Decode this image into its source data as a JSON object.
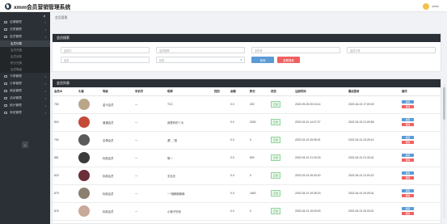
{
  "header": {
    "title": "xmm会员营销管理系统",
    "user_name": "admin"
  },
  "sidebar": {
    "items": [
      {
        "label": "店铺管理",
        "icon": "store-icon"
      },
      {
        "label": "分类管理",
        "icon": "category-icon"
      },
      {
        "label": "会员管理",
        "icon": "member-icon"
      }
    ],
    "sub_items": [
      {
        "label": "会员列表",
        "active": true
      },
      {
        "label": "会员充值",
        "active": false
      },
      {
        "label": "会员消费",
        "active": false
      },
      {
        "label": "积分兑换",
        "active": false
      },
      {
        "label": "会员等级",
        "active": false
      }
    ],
    "items_after": [
      {
        "label": "卡券管理",
        "icon": "coupon-icon"
      },
      {
        "label": "订单管理",
        "icon": "order-icon"
      },
      {
        "label": "商品管理",
        "icon": "goods-icon"
      },
      {
        "label": "活动管理",
        "icon": "activity-icon"
      },
      {
        "label": "统计管理",
        "icon": "stats-icon"
      },
      {
        "label": "系统管理",
        "icon": "settings-icon"
      }
    ]
  },
  "breadcrumb": "会员管理",
  "search": {
    "panel_title": "会员搜索",
    "fields": [
      {
        "placeholder": "会员ID"
      },
      {
        "placeholder": "会员昵称"
      },
      {
        "placeholder": "手机号"
      },
      {
        "placeholder": "会员卡号"
      },
      {
        "placeholder": "会员"
      },
      {
        "placeholder": "状态"
      }
    ],
    "search_label": "查询",
    "reset_label": "重置搜索"
  },
  "list": {
    "panel_title": "会员列表",
    "columns": [
      "会员ID",
      "头像",
      "等级",
      "手机号",
      "昵称",
      "性别",
      "余额",
      "积分",
      "状态",
      "注册时间",
      "最后登录",
      "操作"
    ],
    "edit_label": "编辑",
    "delete_label": "删除",
    "rows": [
      {
        "id": "763",
        "level": "金卡会员",
        "phone": "—",
        "nickname": "TCC",
        "gender": "",
        "balance": "0.0",
        "points": "202",
        "status": "正常",
        "reg": "2022-09-25 20:24:14",
        "last": "2022-04-02 17:00:49",
        "avatar": "#b9a688"
      },
      {
        "id": "824",
        "level": "普通会员",
        "phone": "—",
        "nickname": "我是你的丫头",
        "gender": "",
        "balance": "0.0",
        "points": "2000",
        "status": "正常",
        "reg": "2022-03-21 14:07:27",
        "last": "2022-04-02 21:09:55",
        "avatar": "#c44a3a"
      },
      {
        "id": "794",
        "level": "至尊会员",
        "phone": "—",
        "nickname": "源\" _\"德",
        "gender": "",
        "balance": "0.0",
        "points": "0",
        "status": "正常",
        "reg": "2022-03-19 15:39:01",
        "last": "2022-04-01 23:26:14",
        "avatar": "#5a5a5a"
      },
      {
        "id": "881",
        "level": "标准会员",
        "phone": "—",
        "nickname": "唯一",
        "gender": "",
        "balance": "0.0",
        "points": "800",
        "status": "正常",
        "reg": "2022-04-01 21:33:23",
        "last": "2022-04-01 21:33:41",
        "avatar": "#3b3b3b"
      },
      {
        "id": "823",
        "level": "标准会员",
        "phone": "—",
        "nickname": "无名氏",
        "gender": "",
        "balance": "0.0",
        "points": "0",
        "status": "正常",
        "reg": "2022-03-19 15:33:20",
        "last": "2022-04-01 21:00:22",
        "avatar": "#6b2f3a"
      },
      {
        "id": "879",
        "level": "标准会员",
        "phone": "—",
        "nickname": "一\"哦豚豚豚豚",
        "gender": "",
        "balance": "0.0",
        "points": "1600",
        "status": "正常",
        "reg": "2022-04-01 19:39:23",
        "last": "2022-04-01 20:09:41",
        "avatar": "#8c7f70"
      },
      {
        "id": "876",
        "level": "标准会员",
        "phone": "—",
        "nickname": "小桃子的世",
        "gender": "",
        "balance": "0.0",
        "points": "0",
        "status": "正常",
        "reg": "2022-04-01 19:03:03",
        "last": "2022-04-01 20:03:01",
        "avatar": "#c9a99a"
      }
    ]
  }
}
